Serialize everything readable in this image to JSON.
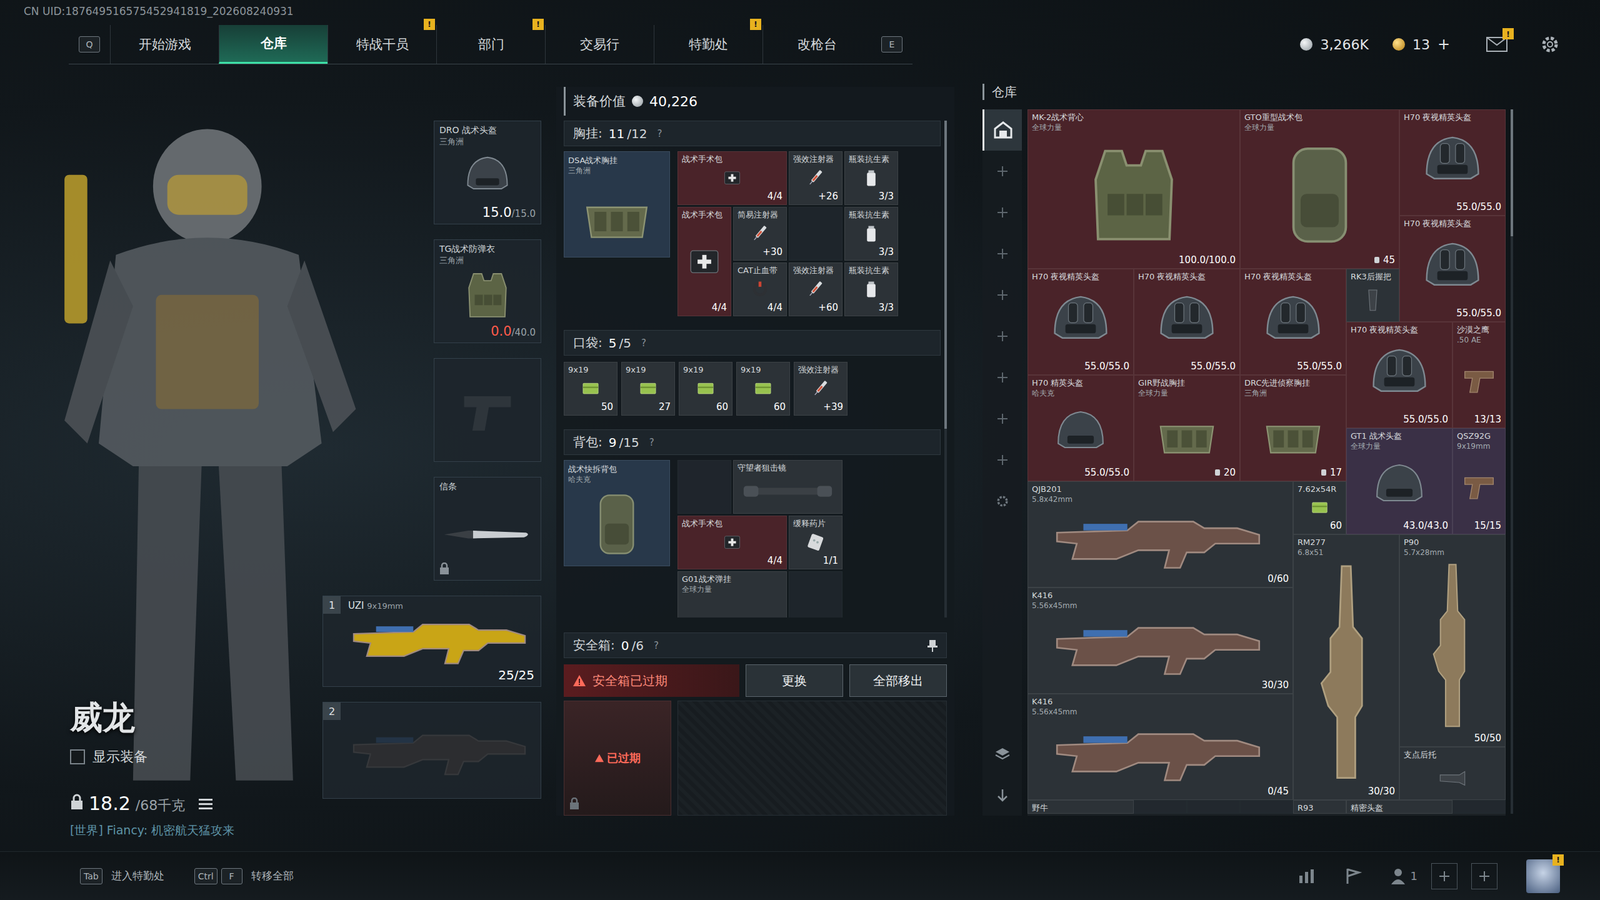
{
  "uid": "CN UID:187649516575452941819_202608240931",
  "nav": {
    "prev_key": "Q",
    "next_key": "E",
    "alert_mark": "!",
    "tabs": [
      {
        "label": "开始游戏",
        "selected": false,
        "alert": false
      },
      {
        "label": "仓库",
        "selected": true,
        "alert": false
      },
      {
        "label": "特战干员",
        "selected": false,
        "alert": true
      },
      {
        "label": "部门",
        "selected": false,
        "alert": true
      },
      {
        "label": "交易行",
        "selected": false,
        "alert": false
      },
      {
        "label": "特勤处",
        "selected": false,
        "alert": true
      },
      {
        "label": "改枪台",
        "selected": false,
        "alert": false
      }
    ]
  },
  "wallet": {
    "coins": "3,266K",
    "gold": "13",
    "add": "+",
    "mail_alert": true
  },
  "operator": {
    "name": "威龙",
    "show_gear": {
      "label": "显示装备",
      "checked": false
    },
    "weight": "18.2",
    "capacity": "/68千克",
    "chat": "[世界] Fiancy: 机密航天猛攻来"
  },
  "gear": [
    {
      "kind": "helmet",
      "name": "DRO 战术头盔",
      "maker": "三角洲",
      "value": "15.0",
      "max": "/15.0",
      "depleted": false
    },
    {
      "kind": "vest",
      "name": "TG战术防弹衣",
      "maker": "三角洲",
      "value": "0.0",
      "max": "/40.0",
      "depleted": true
    },
    {
      "kind": "empty"
    },
    {
      "kind": "knife",
      "name": "信条",
      "locked": true
    }
  ],
  "weapons": [
    {
      "index": "1",
      "empty": false,
      "name": "UZI",
      "caliber": "9x19mm",
      "ammo": "25/25"
    },
    {
      "index": "2",
      "empty": true
    }
  ],
  "loadout": {
    "value_label": "装备价值",
    "value": "40,226",
    "chest": {
      "label": "胸挂:",
      "used": "11",
      "total": "/12",
      "help": "?",
      "rig": {
        "name": "DSA战术胸挂",
        "maker": "三角洲"
      },
      "items": [
        {
          "name": "战术手术包",
          "count": "4/4",
          "kind": "medkit",
          "color": "#4a2329"
        },
        {
          "name": "强效注射器",
          "count": "+26",
          "kind": "syringe",
          "color": "#2c3237"
        },
        {
          "name": "瓶装抗生素",
          "count": "3/3",
          "kind": "bottle",
          "color": "#2c3237"
        },
        {
          "name": "战术手术包",
          "count": "4/4",
          "kind": "medkit",
          "color": "#4a2329"
        },
        {
          "name": "简易注射器",
          "count": "+30",
          "kind": "syringe",
          "color": "#2c3237"
        },
        {
          "name": "瓶装抗生素",
          "count": "3/3",
          "kind": "bottle",
          "color": "#2c3237"
        },
        {
          "name": "CAT止血带",
          "count": "4/4",
          "kind": "tourniquet",
          "color": "#2c3237"
        },
        {
          "name": "强效注射器",
          "count": "+60",
          "kind": "syringe",
          "color": "#2c3237"
        },
        {
          "name": "瓶装抗生素",
          "count": "3/3",
          "kind": "bottle",
          "color": "#2c3237"
        }
      ]
    },
    "pockets": {
      "label": "口袋:",
      "used": "5",
      "total": "/5",
      "help": "?",
      "items": [
        {
          "name": "9x19",
          "count": "50",
          "kind": "ammo"
        },
        {
          "name": "9x19",
          "count": "27",
          "kind": "ammo"
        },
        {
          "name": "9x19",
          "count": "60",
          "kind": "ammo"
        },
        {
          "name": "9x19",
          "count": "60",
          "kind": "ammo"
        },
        {
          "name": "强效注射器",
          "count": "+39",
          "kind": "syringe"
        }
      ]
    },
    "backpack": {
      "label": "背包:",
      "used": "9",
      "total": "/15",
      "help": "?",
      "bag": {
        "name": "战术快拆背包",
        "maker": "哈夫克"
      },
      "items": [
        {
          "name": "守望者狙击镜",
          "count": "",
          "kind": "scope",
          "color": "#2c3237"
        },
        {
          "name": "战术手术包",
          "count": "4/4",
          "kind": "medkit",
          "color": "#4a2329"
        },
        {
          "name": "缓释药片",
          "count": "1/1",
          "kind": "pill",
          "color": "#2c3237"
        },
        {
          "name": "G01战术弹挂",
          "maker": "全球力量",
          "count": "",
          "kind": "rig",
          "color": "#2c3237"
        }
      ]
    },
    "safebox": {
      "label": "安全箱:",
      "used": "0",
      "total": "/6",
      "help": "?",
      "warning": "安全箱已过期",
      "buttons": [
        "更换",
        "全部移出"
      ],
      "case_status": "已过期"
    }
  },
  "warehouse": {
    "title": "仓库",
    "sidebar": [
      {
        "kind": "warehouse",
        "selected": true
      },
      {
        "kind": "add",
        "selected": false
      },
      {
        "kind": "add",
        "selected": false
      },
      {
        "kind": "add",
        "selected": false
      },
      {
        "kind": "add",
        "selected": false
      },
      {
        "kind": "add",
        "selected": false
      },
      {
        "kind": "add",
        "selected": false
      },
      {
        "kind": "add",
        "selected": false
      },
      {
        "kind": "add",
        "selected": false
      },
      {
        "kind": "settings",
        "selected": false
      }
    ],
    "items": [
      {
        "name": "MK-2战术背心",
        "maker": "全球力量",
        "stat": "100.0/100.0",
        "kind": "vest",
        "color": "#4a2329"
      },
      {
        "name": "GTO重型战术包",
        "maker": "全球力量",
        "cap": "45",
        "kind": "bag",
        "color": "#4a2329"
      },
      {
        "name": "H70 夜视精英头盔",
        "stat": "55.0/55.0",
        "kind": "nvg",
        "color": "#4a2329"
      },
      {
        "name": "H70 夜视精英头盔",
        "stat": "55.0/55.0",
        "kind": "nvg",
        "color": "#4a2329"
      },
      {
        "name": "H70 夜视精英头盔",
        "stat": "55.0/55.0",
        "kind": "nvg",
        "color": "#4a2329"
      },
      {
        "name": "H70 夜视精英头盔",
        "stat": "55.0/55.0",
        "kind": "nvg",
        "color": "#4a2329"
      },
      {
        "name": "H70 夜视精英头盔",
        "stat": "55.0/55.0",
        "kind": "nvg",
        "color": "#4a2329"
      },
      {
        "name": "RK3后握把",
        "kind": "grip",
        "color": "#2c3237"
      },
      {
        "name": "H70 夜视精英头盔",
        "stat": "55.0/55.0",
        "kind": "nvg",
        "color": "#4a2329"
      },
      {
        "name": "沙漠之鹰",
        "maker": ".50 AE",
        "stat": "13/13",
        "kind": "pistol",
        "color": "#4a2329"
      },
      {
        "name": "H70 精英头盔",
        "maker": "哈夫克",
        "stat": "55.0/55.0",
        "kind": "helmet",
        "color": "#4a2329"
      },
      {
        "name": "GIR野战胸挂",
        "maker": "全球力量",
        "cap": "20",
        "kind": "rig",
        "color": "#4a2329"
      },
      {
        "name": "DRC先进侦察胸挂",
        "maker": "三角洲",
        "cap": "17",
        "kind": "rig",
        "color": "#4a2329"
      },
      {
        "name": "GT1 战术头盔",
        "maker": "全球力量",
        "stat": "43.0/43.0",
        "kind": "helmet",
        "color": "#3a3046"
      },
      {
        "name": "QSZ92G",
        "maker": "9x19mm",
        "stat": "15/15",
        "kind": "pistol",
        "color": "#3a3046"
      },
      {
        "name": "QJB201",
        "maker": "5.8x42mm",
        "stat": "0/60",
        "kind": "rifle",
        "color": "#2c3237"
      },
      {
        "name": "7.62x54R",
        "stat": "60",
        "kind": "ammo",
        "color": "#2c3237"
      },
      {
        "name": "RM277",
        "maker": "6.8x51",
        "stat": "30/30",
        "kind": "rifle-v",
        "color": "#2c3237"
      },
      {
        "name": "P90",
        "maker": "5.7x28mm",
        "stat": "50/50",
        "kind": "rifle-v",
        "color": "#2c3237"
      },
      {
        "name": "K416",
        "maker": "5.56x45mm",
        "stat": "30/30",
        "kind": "rifle",
        "color": "#2c3237"
      },
      {
        "name": "K416",
        "maker": "5.56x45mm",
        "stat": "0/45",
        "kind": "rifle",
        "color": "#2c3237"
      },
      {
        "name": "支点后托",
        "kind": "stock",
        "color": "#2c3237"
      },
      {
        "name": "野牛",
        "kind": "rifle",
        "color": "#2c3237"
      },
      {
        "name": "R93",
        "kind": "rifle",
        "color": "#2c3237"
      },
      {
        "name": "精密头盔",
        "kind": "helmet",
        "color": "#2c3237"
      }
    ]
  },
  "bottom": {
    "hints": [
      {
        "keys": [
          "Tab"
        ],
        "label": "进入特勤处"
      },
      {
        "keys": [
          "Ctrl",
          "F"
        ],
        "label": "转移全部"
      }
    ],
    "squad": "1",
    "avatar_alert": true
  }
}
